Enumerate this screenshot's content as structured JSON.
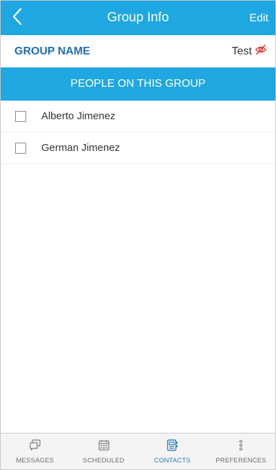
{
  "header": {
    "title": "Group Info",
    "edit_label": "Edit",
    "back_icon": "chevron-left-icon"
  },
  "group": {
    "label": "GROUP NAME",
    "value": "Test",
    "visibility_icon": "eye-slash-icon"
  },
  "people_section": {
    "title": "PEOPLE ON THIS GROUP",
    "people": [
      {
        "name": "Alberto Jimenez",
        "checked": false
      },
      {
        "name": "German Jimenez",
        "checked": false
      }
    ]
  },
  "tabbar": {
    "tabs": [
      {
        "label": "MESSAGES",
        "icon": "messages-icon",
        "active": false
      },
      {
        "label": "SCHEDULED",
        "icon": "calendar-icon",
        "active": false
      },
      {
        "label": "CONTACTS",
        "icon": "contacts-icon",
        "active": true
      },
      {
        "label": "PREFERENCES",
        "icon": "more-vertical-icon",
        "active": false
      }
    ]
  },
  "colors": {
    "brand_blue": "#1ea7e1",
    "group_label": "#1e6fb3",
    "active_tab": "#2a7fc4",
    "eye_slash": "#e53935"
  }
}
